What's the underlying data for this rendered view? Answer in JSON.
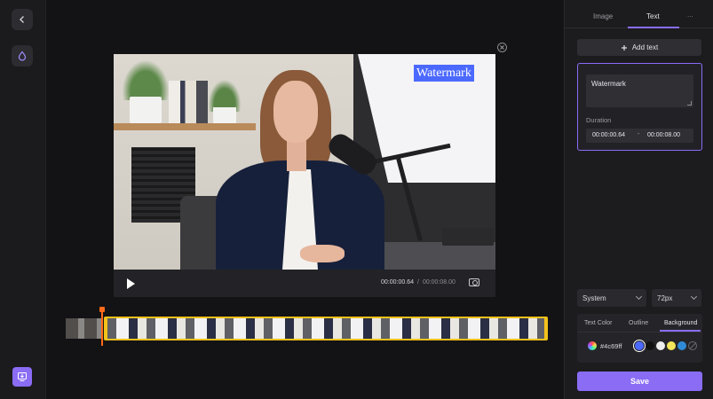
{
  "sidebar": {
    "back_icon": "chevron-left-icon",
    "watermark_tool_icon": "droplet-icon",
    "export_icon": "monitor-download-icon"
  },
  "player": {
    "watermark_text": "Watermark",
    "current_time": "00:00:00.64",
    "separator": "/",
    "total_time": "00:00:08.00",
    "watermark_bg_color": "#4c69ff"
  },
  "panel": {
    "tabs": [
      "Image",
      "Text",
      "..."
    ],
    "active_tab": "Text",
    "add_text_label": "Add text",
    "text_value": "Watermark",
    "duration_label": "Duration",
    "duration_start": "00:00:00.64",
    "duration_dash": "-",
    "duration_end": "00:00:08.00",
    "font_family": "System",
    "font_size": "72px",
    "style_tabs": [
      "Text Color",
      "Outline",
      "Background"
    ],
    "active_style_tab": "Background",
    "hex_value": "#4c69ff",
    "swatches": [
      "#4c69ff",
      "#111111",
      "#eeeeee",
      "#f3e65a",
      "#2f8bd8"
    ],
    "save_label": "Save"
  },
  "colors": {
    "accent": "#8a6cf5",
    "timeline_border": "#f3c21b",
    "playhead": "#ff6a1a"
  }
}
